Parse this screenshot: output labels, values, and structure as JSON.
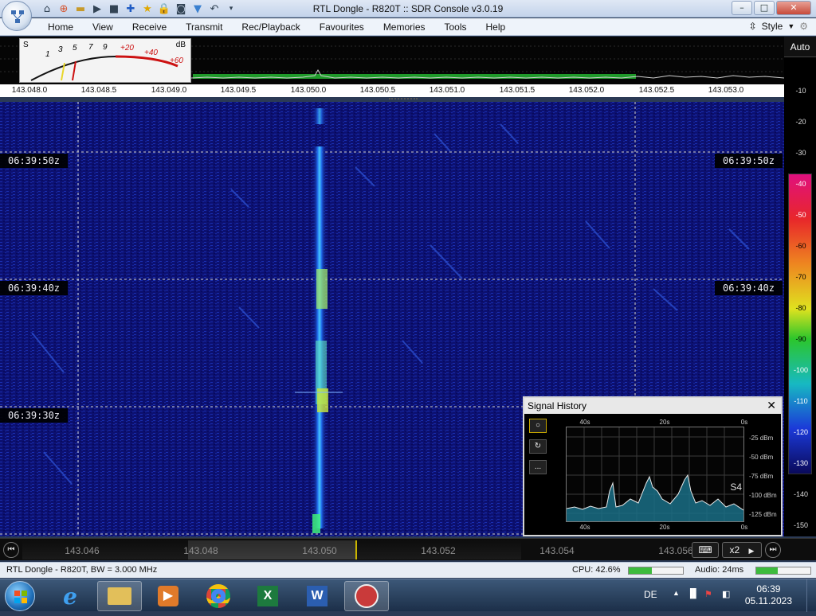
{
  "titlebar": {
    "title": "RTL Dongle - R820T :: SDR Console v3.0.19"
  },
  "window_controls": {
    "minimize": "–",
    "maximize": "□",
    "close": "✕"
  },
  "menu": {
    "items": [
      "Home",
      "View",
      "Receive",
      "Transmit",
      "Rec/Playback",
      "Favourites",
      "Memories",
      "Tools",
      "Help"
    ],
    "style_label": "Style"
  },
  "meter": {
    "s_label": "S",
    "db_label": "dB",
    "s_scale": [
      "1",
      "3",
      "5",
      "7",
      "9"
    ],
    "db_scale": [
      "+20",
      "+40",
      "+60"
    ]
  },
  "freq_scale": {
    "labels": [
      "143.048.0",
      "143.048.5",
      "143.049.0",
      "143.049.5",
      "143.050.0",
      "143.050.5",
      "143.051.0",
      "143.051.5",
      "143.052.0",
      "143.052.5",
      "143.053.0"
    ]
  },
  "level_scale": {
    "auto_label": "Auto",
    "values": [
      "-10",
      "-20",
      "-30",
      "-40",
      "-50",
      "-60",
      "-70",
      "-80",
      "-90",
      "-100",
      "-110",
      "-120",
      "-130",
      "-140",
      "-150"
    ]
  },
  "waterfall": {
    "timestamps": [
      "06:39:50z",
      "06:39:40z",
      "06:39:30z"
    ]
  },
  "bottom_scale": {
    "labels": [
      "143.046",
      "143.048",
      "143.050",
      "143.052",
      "143.054",
      "143.056"
    ],
    "zoom_label": "x2"
  },
  "signal_history": {
    "title": "Signal History",
    "close": "✕",
    "x_labels": [
      "40s",
      "20s",
      "0s"
    ],
    "y_labels": [
      "-25 dBm",
      "-50 dBm",
      "-75 dBm",
      "-100 dBm",
      "-125 dBm"
    ],
    "s_reading": "S4",
    "buttons": [
      "○",
      "↻",
      "..."
    ]
  },
  "status": {
    "device": "RTL Dongle - R820T, BW = 3.000 MHz",
    "cpu": "CPU: 42.6%",
    "cpu_percent": 42.6,
    "audio": "Audio: 24ms",
    "audio_level": 0.4
  },
  "taskbar": {
    "language": "DE",
    "time": "06:39",
    "date": "05.11.2023"
  }
}
